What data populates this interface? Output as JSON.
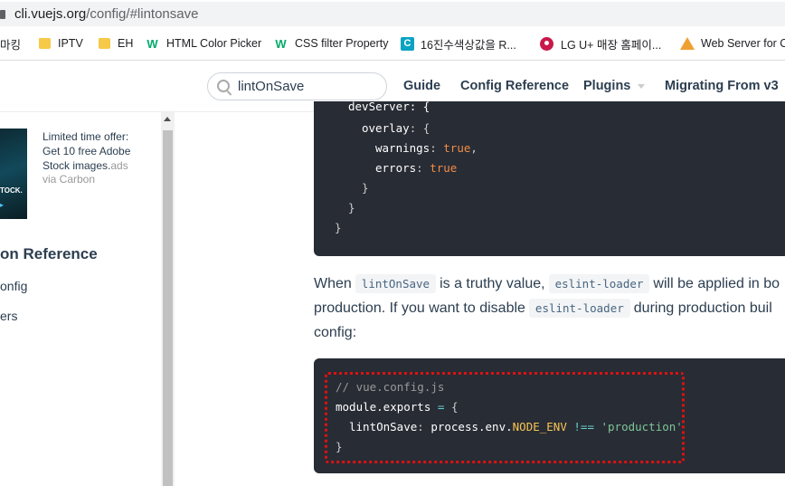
{
  "browser": {
    "url_host": "cli.vuejs.org",
    "url_path": "/config/#lintonsave"
  },
  "bookmarks": [
    {
      "label": "마킹",
      "icon": "folder-icon"
    },
    {
      "label": "IPTV",
      "icon": "folder-icon"
    },
    {
      "label": "EH",
      "icon": "folder-icon"
    },
    {
      "label": "HTML Color Picker",
      "icon": "w3schools-icon"
    },
    {
      "label": "CSS filter Property",
      "icon": "w3schools-icon"
    },
    {
      "label": "16진수색상값을 R...",
      "icon": "c-icon"
    },
    {
      "label": "LG U+ 매장 홈페이...",
      "icon": "lg-icon"
    },
    {
      "label": "Web Server for C",
      "icon": "web-server-icon"
    }
  ],
  "header": {
    "search_value": "lintOnSave",
    "nav": [
      "Guide",
      "Config Reference",
      "Plugins",
      "Migrating From v3"
    ],
    "accent": "#42b983"
  },
  "sidebar": {
    "ad_line1": "Limited time offer:",
    "ad_line2": "Get 10 free Adobe",
    "ad_line3": "Stock images.",
    "ad_tag": "ads",
    "ad_via": "via Carbon",
    "ad_image_text": "TOCK.",
    "title": "on Reference",
    "links": [
      "onfig",
      "ers"
    ]
  },
  "code_top": {
    "l1": "devServer: {",
    "l2_key": "overlay",
    "l3_key": "warnings",
    "l3_val": "true",
    "l4_key": "errors",
    "l4_val": "true"
  },
  "paragraph": {
    "w_when": "When",
    "c1": "lintOnSave",
    "w_truthy": "is a truthy value,",
    "c2": "eslint-loader",
    "w_applied": "will be applied in bo",
    "w_production": "production. If you want to disable",
    "c3": "eslint-loader",
    "w_during": "during production buil",
    "w_config": "config:"
  },
  "code_bottom": {
    "comment": "// vue.config.js",
    "l1": "module.exports",
    "l2_key": "lintOnSave",
    "l2_obj": "process.env.",
    "l2_env": "NODE_ENV",
    "l2_op": "!==",
    "l2_str": "'production'"
  }
}
